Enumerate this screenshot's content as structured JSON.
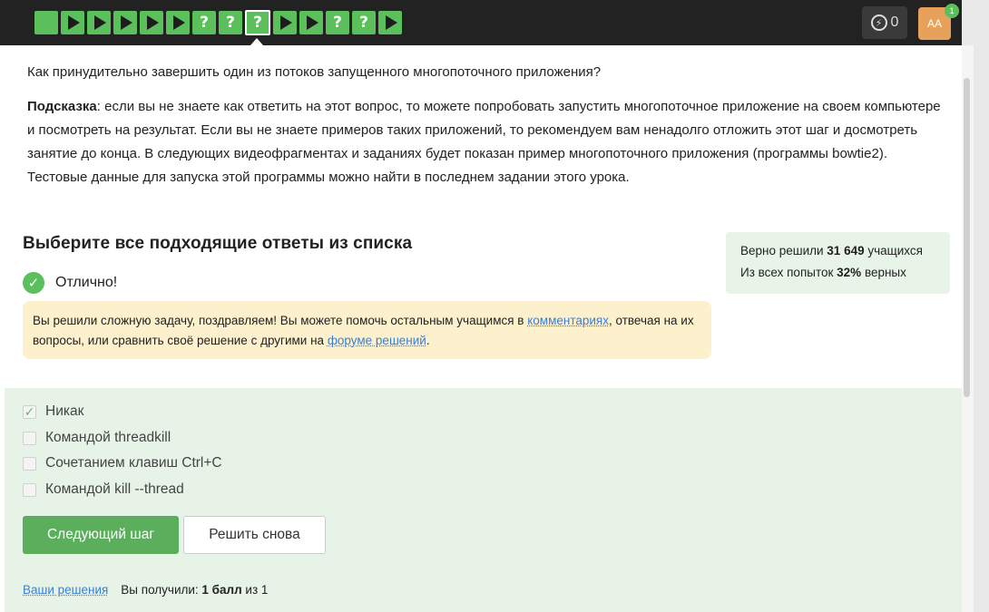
{
  "steps": [
    {
      "type": "done",
      "icon": ""
    },
    {
      "type": "video",
      "icon": "play"
    },
    {
      "type": "video",
      "icon": "play"
    },
    {
      "type": "video",
      "icon": "play"
    },
    {
      "type": "video",
      "icon": "play"
    },
    {
      "type": "video",
      "icon": "play"
    },
    {
      "type": "quiz",
      "icon": "?"
    },
    {
      "type": "quiz",
      "icon": "?"
    },
    {
      "type": "quiz-current",
      "icon": "?"
    },
    {
      "type": "video",
      "icon": "play"
    },
    {
      "type": "video",
      "icon": "play"
    },
    {
      "type": "quiz",
      "icon": "?"
    },
    {
      "type": "quiz",
      "icon": "?"
    },
    {
      "type": "video",
      "icon": "play"
    }
  ],
  "header": {
    "energy_count": "0",
    "avatar_initials": "АА",
    "notification_count": "1"
  },
  "question": "Как принудительно завершить один из потоков запущенного многопоточного приложения?",
  "hint": {
    "label": "Подсказка",
    "text": ": если вы не знаете как ответить на этот вопрос, то можете попробовать запустить многопоточное приложение на своем компьютере и посмотреть на результат. Если вы не знаете примеров таких приложений, то рекомендуем вам ненадолго отложить этот шаг и досмотреть занятие до конца. В следующих видеофрагментах и заданиях будет показан пример многопоточного приложения (программы bowtie2). Тестовые данные для запуска этой программы можно найти в последнем задании этого урока."
  },
  "task_title": "Выберите все подходящие ответы из списка",
  "result_text": "Отлично!",
  "notice": {
    "part1": "Вы решили сложную задачу, поздравляем! Вы можете помочь остальным учащимся в ",
    "link1": "комментариях",
    "part2": ", отвечая на их вопросы, или сравнить своё решение с другими на ",
    "link2": "форуме решений",
    "part3": "."
  },
  "stats": {
    "line1_prefix": "Верно решили ",
    "line1_value": "31 649",
    "line1_suffix": " учащихся",
    "line2_prefix": "Из всех попыток ",
    "line2_value": "32%",
    "line2_suffix": " верных"
  },
  "options": [
    {
      "label": "Никак",
      "checked": true
    },
    {
      "label": "Командой threadkill",
      "checked": false
    },
    {
      "label": "Сочетанием клавиш Ctrl+C",
      "checked": false
    },
    {
      "label": "Командой kill --thread",
      "checked": false
    }
  ],
  "buttons": {
    "next": "Следующий шаг",
    "retry": "Решить снова"
  },
  "footer": {
    "solutions_link": "Ваши решения",
    "score_prefix": "Вы получили: ",
    "score_value": "1 балл",
    "score_suffix": " из 1"
  },
  "colors": {
    "accent_green": "#5bbf5b",
    "notice_bg": "#fdf0cd",
    "stats_bg": "#e7f4e7",
    "link": "#3a7fd5"
  }
}
